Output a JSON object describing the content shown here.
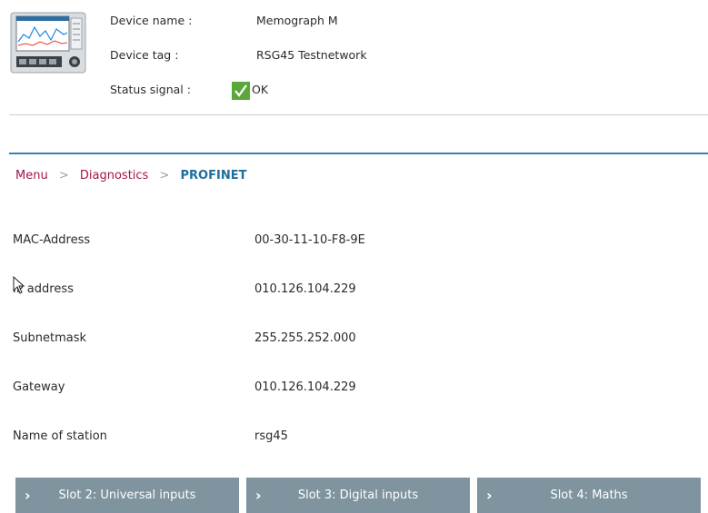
{
  "header": {
    "device_name_label": "Device name :",
    "device_name_value": "Memograph M",
    "device_tag_label": "Device tag :",
    "device_tag_value": "RSG45 Testnetwork",
    "status_label": "Status signal :",
    "status_value": "OK",
    "status_color": "#5aa83a"
  },
  "breadcrumb": {
    "items": [
      "Menu",
      "Diagnostics"
    ],
    "separator": ">",
    "current": "PROFINET"
  },
  "details": [
    {
      "label": "MAC-Address",
      "value": "00-30-11-10-F8-9E"
    },
    {
      "label": "IP address",
      "value": "010.126.104.229"
    },
    {
      "label": "Subnetmask",
      "value": "255.255.252.000"
    },
    {
      "label": "Gateway",
      "value": "010.126.104.229"
    },
    {
      "label": "Name of station",
      "value": "rsg45"
    }
  ],
  "slots": [
    {
      "label": "Slot 2: Universal inputs",
      "icon": "chevron-right-icon"
    },
    {
      "label": "Slot 3: Digital inputs",
      "icon": "chevron-right-icon"
    },
    {
      "label": "Slot 4: Maths",
      "icon": "chevron-right-icon"
    }
  ],
  "colors": {
    "accent_blue": "#2f86b8",
    "link_magenta": "#a3154f",
    "button_bg": "#7f949f"
  }
}
